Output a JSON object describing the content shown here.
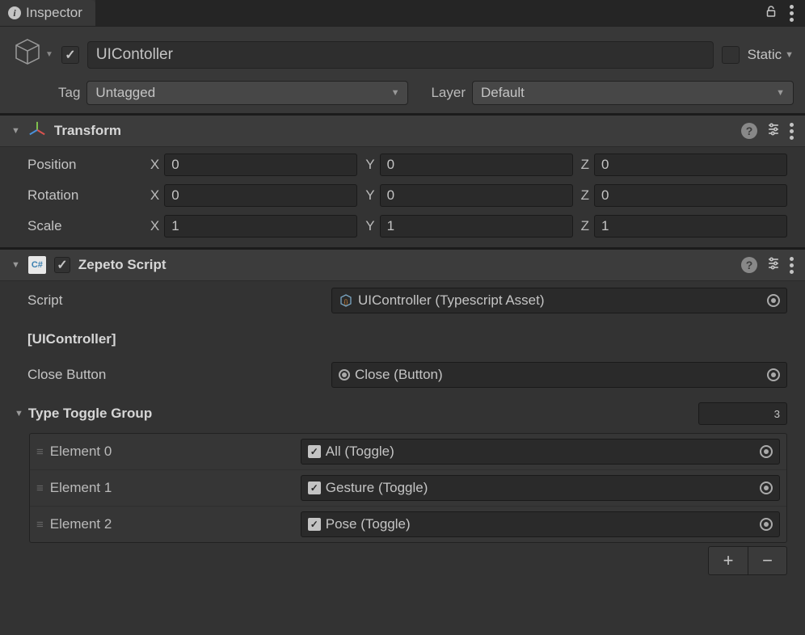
{
  "tab": {
    "title": "Inspector"
  },
  "header": {
    "enabled": true,
    "name": "UIContoller",
    "static_label": "Static",
    "tag_label": "Tag",
    "tag_value": "Untagged",
    "layer_label": "Layer",
    "layer_value": "Default"
  },
  "transform": {
    "title": "Transform",
    "position": {
      "label": "Position",
      "x": "0",
      "y": "0",
      "z": "0"
    },
    "rotation": {
      "label": "Rotation",
      "x": "0",
      "y": "0",
      "z": "0"
    },
    "scale": {
      "label": "Scale",
      "x": "1",
      "y": "1",
      "z": "1"
    }
  },
  "zepeto": {
    "title": "Zepeto Script",
    "enabled": true,
    "script_label": "Script",
    "script_value": "UIController (Typescript Asset)",
    "bracket": "[UIController]",
    "close_label": "Close Button",
    "close_value": "Close (Button)",
    "list_label": "Type Toggle Group",
    "list_count": "3",
    "elements": [
      {
        "label": "Element 0",
        "value": "All  (Toggle)"
      },
      {
        "label": "Element 1",
        "value": "Gesture (Toggle)"
      },
      {
        "label": "Element 2",
        "value": "Pose (Toggle)"
      }
    ]
  }
}
